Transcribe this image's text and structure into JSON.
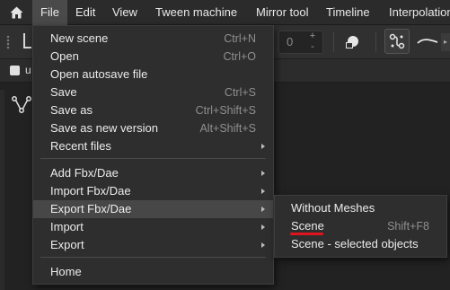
{
  "menubar": {
    "items": [
      {
        "label": "File"
      },
      {
        "label": "Edit"
      },
      {
        "label": "View"
      },
      {
        "label": "Tween machine"
      },
      {
        "label": "Mirror tool"
      },
      {
        "label": "Timeline"
      },
      {
        "label": "Interpolation"
      }
    ]
  },
  "toolbar": {
    "number_value": "0",
    "spin_up": "+",
    "spin_down": "-"
  },
  "tabbar": {
    "tab_label": "u"
  },
  "file_menu": {
    "items": [
      {
        "label": "New scene",
        "shortcut": "Ctrl+N"
      },
      {
        "label": "Open",
        "shortcut": "Ctrl+O"
      },
      {
        "label": "Open autosave file",
        "shortcut": ""
      },
      {
        "label": "Save",
        "shortcut": "Ctrl+S"
      },
      {
        "label": "Save as",
        "shortcut": "Ctrl+Shift+S"
      },
      {
        "label": "Save as new version",
        "shortcut": "Alt+Shift+S"
      },
      {
        "label": "Recent files",
        "shortcut": "",
        "submenu": true
      },
      {
        "label": "Add Fbx/Dae",
        "shortcut": "",
        "submenu": true
      },
      {
        "label": "Import Fbx/Dae",
        "shortcut": "",
        "submenu": true
      },
      {
        "label": "Export Fbx/Dae",
        "shortcut": "",
        "submenu": true,
        "highlighted": true
      },
      {
        "label": "Import",
        "shortcut": "",
        "submenu": true
      },
      {
        "label": "Export",
        "shortcut": "",
        "submenu": true
      },
      {
        "label": "Home",
        "shortcut": ""
      }
    ]
  },
  "export_submenu": {
    "items": [
      {
        "label": "Without Meshes",
        "shortcut": ""
      },
      {
        "label": "Scene",
        "shortcut": "Shift+F8",
        "annotated": true
      },
      {
        "label": "Scene - selected objects",
        "shortcut": ""
      }
    ]
  },
  "colors": {
    "menu_bg": "#2e2e2e",
    "highlight": "#474747",
    "annotation_underline": "#e0141e"
  },
  "icons": [
    "home-icon",
    "transform-icon",
    "shape-icon",
    "curve-icon",
    "line-icon",
    "graph-icon",
    "submenu-arrow-icon"
  ]
}
